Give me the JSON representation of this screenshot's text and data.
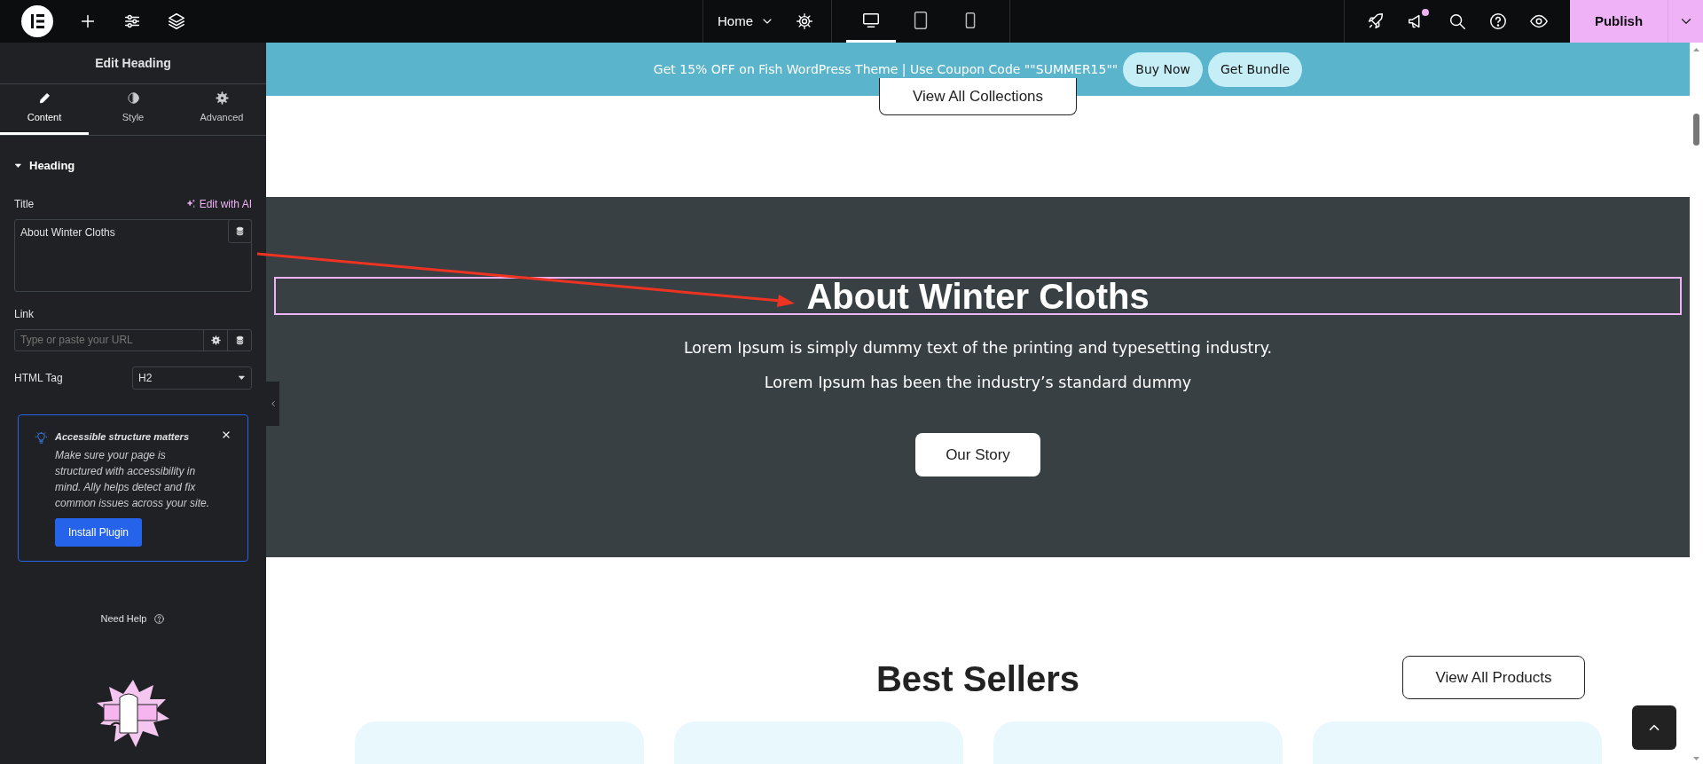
{
  "topbar": {
    "page_selector": "Home",
    "devices": [
      {
        "kind": "desktop",
        "selected": true
      },
      {
        "kind": "tablet",
        "selected": false
      },
      {
        "kind": "mobile",
        "selected": false
      }
    ],
    "notification_dot": true,
    "publish": "Publish"
  },
  "sidebar": {
    "title": "Edit Heading",
    "tabs": [
      {
        "kind": "content",
        "label": "Content",
        "selected": true
      },
      {
        "kind": "style",
        "label": "Style",
        "selected": false
      },
      {
        "kind": "advanced",
        "label": "Advanced",
        "selected": false
      }
    ],
    "section": {
      "label": "Heading",
      "expanded": true
    },
    "title_field": {
      "label": "Title",
      "ai_link": "Edit with AI",
      "value": "About Winter Cloths"
    },
    "link_field": {
      "label": "Link",
      "placeholder": "Type or paste your URL"
    },
    "html_tag": {
      "label": "HTML Tag",
      "value": "H2"
    },
    "notice": {
      "title": "Accessible structure matters",
      "text": "Make sure your page is structured with accessibility in mind. Ally helps detect and fix common issues across your site.",
      "button": "Install Plugin"
    },
    "need_help": "Need Help"
  },
  "canvas": {
    "banner": {
      "text": "Get 15% OFF on Fish WordPress Theme | Use Coupon Code \"\"SUMMER15\"\"",
      "buttons": [
        "Buy Now",
        "Get Bundle"
      ]
    },
    "collections_button": "View All Collections",
    "about": {
      "heading": "About Winter Cloths",
      "heading_selected": true,
      "text": "Lorem Ipsum is simply dummy text of the printing and typesetting industry. Lorem Ipsum has been the industry’s standard dummy",
      "button": "Our Story"
    },
    "best_sellers": {
      "heading": "Best Sellers",
      "button": "View All Products",
      "cards": [
        {
          "kind": "card"
        },
        {
          "kind": "card"
        },
        {
          "kind": "card"
        },
        {
          "kind": "card"
        }
      ]
    }
  }
}
